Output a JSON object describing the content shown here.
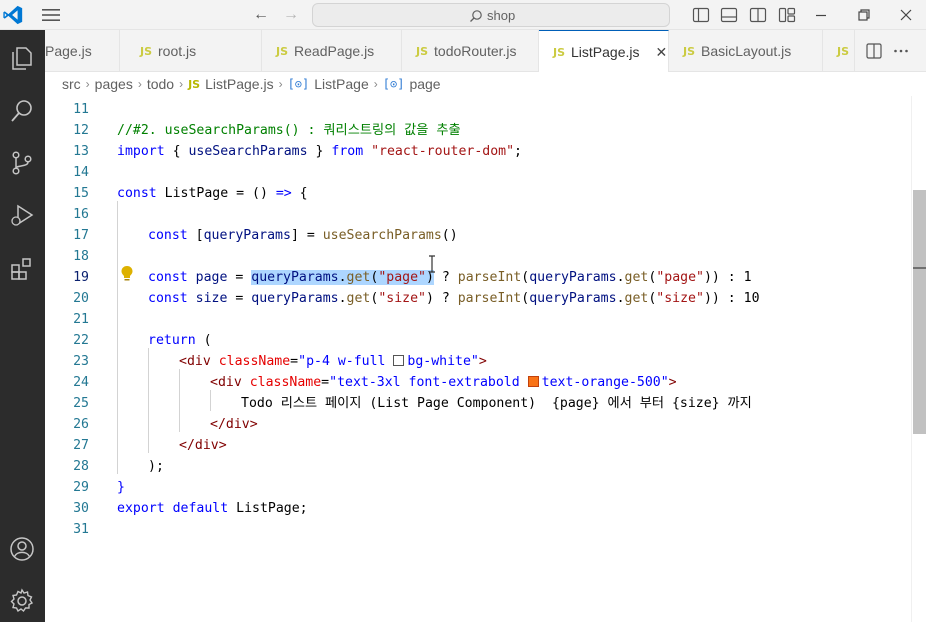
{
  "titlebar": {
    "search_text": "shop",
    "icons": [
      "vscode-logo-icon",
      "menu-icon",
      "back-arrow-icon",
      "forward-arrow-icon",
      "search-icon",
      "toggle-sidebar-icon",
      "toggle-panel-icon",
      "toggle-secondary-sidebar-icon",
      "customize-layout-icon",
      "minimize-icon",
      "restore-icon",
      "close-window-icon"
    ]
  },
  "activity_bar": {
    "items": [
      "explorer-icon",
      "search-icon",
      "source-control-icon",
      "run-debug-icon",
      "extensions-icon",
      "accounts-icon",
      "manage-gear-icon"
    ]
  },
  "tabs": [
    {
      "label": "Page.js",
      "badge": "JS",
      "active": false
    },
    {
      "label": "root.js",
      "badge": "JS",
      "active": false
    },
    {
      "label": "ReadPage.js",
      "badge": "JS",
      "active": false
    },
    {
      "label": "todoRouter.js",
      "badge": "JS",
      "active": false
    },
    {
      "label": "ListPage.js",
      "badge": "JS",
      "active": true
    },
    {
      "label": "BasicLayout.js",
      "badge": "JS",
      "active": false
    },
    {
      "label": "",
      "badge": "JS",
      "active": false
    }
  ],
  "tab_close_glyph": "✕",
  "breadcrumbs": {
    "parts": [
      "src",
      "pages",
      "todo"
    ],
    "file": "ListPage.js",
    "file_badge": "JS",
    "symbol1": "ListPage",
    "symbol2": "page",
    "symbol_glyph": "[⊙]",
    "sep": "›"
  },
  "editor": {
    "current_line": 19,
    "line_numbers": [
      "11",
      "12",
      "13",
      "14",
      "15",
      "16",
      "17",
      "18",
      "19",
      "20",
      "21",
      "22",
      "23",
      "24",
      "25",
      "26",
      "27",
      "28",
      "29",
      "30",
      "31"
    ],
    "code": {
      "l12": "//#2. useSearchParams() : 쿼리스트링의 값을 추출",
      "l13_import": "import",
      "l13_a": " { ",
      "l13_b": "useSearchParams",
      "l13_c": " } ",
      "l13_from": "from",
      "l13_d": " ",
      "l13_str": "\"react-router-dom\"",
      "l13_e": ";",
      "l15_const": "const",
      "l15_a": " ",
      "l15_name": "ListPage",
      "l15_b": " = () ",
      "l15_arrow": "=>",
      "l15_c": " {",
      "l17_const": "const",
      "l17_a": " [",
      "l17_var": "queryParams",
      "l17_b": "] = ",
      "l17_fn": "useSearchParams",
      "l17_c": "()",
      "l19_const": "const",
      "l19_a": " ",
      "l19_var": "page",
      "l19_b": " = ",
      "l19_sel_var": "queryParams",
      "l19_sel_dot": ".",
      "l19_sel_fn": "get",
      "l19_sel_p1": "(",
      "l19_sel_str": "\"page\"",
      "l19_sel_p2": ")",
      "l19_c": " ? ",
      "l19_fn2": "parseInt",
      "l19_d": "(",
      "l19_var2": "queryParams",
      "l19_e": ".",
      "l19_fn3": "get",
      "l19_f": "(",
      "l19_str2": "\"page\"",
      "l19_g": ")) : ",
      "l19_num": "1",
      "l20_const": "const",
      "l20_a": " ",
      "l20_var": "size",
      "l20_b": " = ",
      "l20_var2": "queryParams",
      "l20_c": ".",
      "l20_fn": "get",
      "l20_d": "(",
      "l20_str": "\"size\"",
      "l20_e": ") ? ",
      "l20_fn2": "parseInt",
      "l20_f": "(",
      "l20_var3": "queryParams",
      "l20_g": ".",
      "l20_fn3": "get",
      "l20_h": "(",
      "l20_str2": "\"size\"",
      "l20_i": ")) : ",
      "l20_num": "10",
      "l22_return": "return",
      "l22_a": " (",
      "l23_open": "<div",
      "l23_attr": " className",
      "l23_eq": "=",
      "l23_str1": "\"p-4 w-full ",
      "l23_str2": "bg-white\"",
      "l23_close": ">",
      "l24_open": "<div",
      "l24_attr": " className",
      "l24_eq": "=",
      "l24_str1": "\"text-3xl font-extrabold ",
      "l24_str2": "text-orange-500\"",
      "l24_close": ">",
      "l25": "Todo 리스트 페이지 (List Page Component)  {page} 에서 부터 {size} 까지",
      "l26": "</div>",
      "l27": "</div>",
      "l28": ");",
      "l29": "}",
      "l30_export": "export",
      "l30_a": " ",
      "l30_default": "default",
      "l30_b": " ",
      "l30_name": "ListPage",
      "l30_c": ";"
    },
    "swatch_white": "#ffffff",
    "swatch_orange": "#f97316"
  },
  "colors": {
    "accent": "#005fb8",
    "activity_bar_bg": "#2c2c2c",
    "selection": "#add6ff"
  }
}
